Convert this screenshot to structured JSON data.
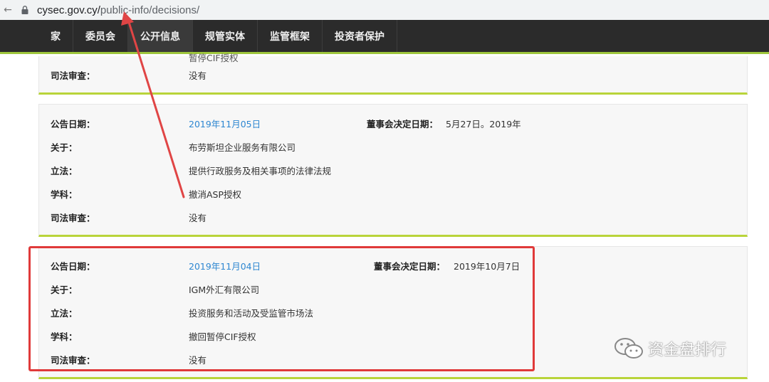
{
  "browser": {
    "url_host": "cysec.gov.cy/",
    "url_path": "public-info/decisions/"
  },
  "nav": {
    "items": [
      {
        "label": "家"
      },
      {
        "label": "委员会"
      },
      {
        "label": "公开信息"
      },
      {
        "label": "规管实体"
      },
      {
        "label": "监管框架"
      },
      {
        "label": "投资者保护"
      }
    ]
  },
  "records": [
    {
      "partial_top": "暂停CIF授权",
      "judicial_label": "司法审查：",
      "judicial_value": "没有"
    },
    {
      "announce_label": "公告日期：",
      "announce_value": "2019年11月05日",
      "board_label": "董事会决定日期：",
      "board_value": "5月27日。2019年",
      "about_label": "关于：",
      "about_value": "布劳斯坦企业服务有限公司",
      "law_label": "立法：",
      "law_value": "提供行政服务及相关事项的法律法规",
      "subject_label": "学科：",
      "subject_value": "撤消ASP授权",
      "judicial_label": "司法审查：",
      "judicial_value": "没有"
    },
    {
      "announce_label": "公告日期：",
      "announce_value": "2019年11月04日",
      "board_label": "董事会决定日期：",
      "board_value": "2019年10月7日",
      "about_label": "关于：",
      "about_value": "IGM外汇有限公司",
      "law_label": "立法：",
      "law_value": "投资服务和活动及受监管市场法",
      "subject_label": "学科：",
      "subject_value": "撤回暂停CIF授权",
      "judicial_label": "司法审查：",
      "judicial_value": "没有"
    }
  ],
  "watermark": {
    "text": "资金盘排行"
  },
  "colors": {
    "accent_green": "#b9d43a",
    "link_blue": "#2e87d1",
    "highlight_red": "#e03a3a",
    "nav_bg": "#2b2b2b"
  }
}
